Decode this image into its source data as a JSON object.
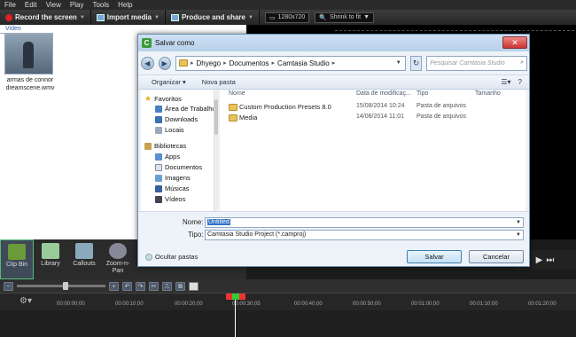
{
  "menu": [
    "File",
    "Edit",
    "View",
    "Play",
    "Tools",
    "Help"
  ],
  "toolbar": {
    "record": "Record the screen",
    "import": "Import media",
    "produce": "Produce and share",
    "resolution": "1280x720",
    "fit": "Shrink to fit"
  },
  "clipbin": {
    "section": "Video",
    "clip_label": "armas de connor dreamscene.wmv"
  },
  "tabs": [
    {
      "label": "Clip Bin"
    },
    {
      "label": "Library"
    },
    {
      "label": "Callouts"
    },
    {
      "label": "Zoom-n-Pan"
    }
  ],
  "timeline": {
    "ticks": [
      "00:00:00;00",
      "00:00:10;00",
      "00:00:20;00",
      "00:00:30;05",
      "00:00:40;00",
      "00:00:50;00",
      "00:01:00;00",
      "00:01:10;00",
      "00:01:20;00"
    ]
  },
  "dialog": {
    "title": "Salvar como",
    "breadcrumb": [
      "Dhyego",
      "Documentos",
      "Camtasia Studio"
    ],
    "search_placeholder": "Pesquisar Camtasia Studio",
    "organize": "Organizar",
    "new_folder": "Nova pasta",
    "nav": {
      "favorites": "Favoritos",
      "fav_items": [
        "Área de Trabalho",
        "Downloads",
        "Locais"
      ],
      "libraries": "Bibliotecas",
      "lib_items": [
        "Apps",
        "Documentos",
        "Imagens",
        "Músicas",
        "Vídeos"
      ]
    },
    "columns": {
      "name": "Nome",
      "date": "Data de modificaç...",
      "type": "Tipo",
      "size": "Tamanho"
    },
    "files": [
      {
        "name": "Custom Production Presets 8.0",
        "date": "15/08/2014 10:24",
        "type": "Pasta de arquivos"
      },
      {
        "name": "Media",
        "date": "14/08/2014 11:01",
        "type": "Pasta de arquivos"
      }
    ],
    "name_label": "Nome:",
    "name_value": "Untitled",
    "type_label": "Tipo:",
    "type_value": "Camtasia Studio Project (*.camproj)",
    "hide_folders": "Ocultar pastas",
    "save": "Salvar",
    "cancel": "Cancelar"
  }
}
